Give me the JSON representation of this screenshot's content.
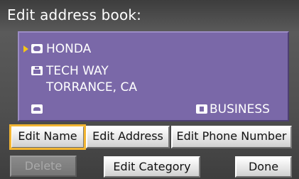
{
  "screen": {
    "title": "Edit address book:"
  },
  "entry": {
    "name": "HONDA",
    "street": "TECH WAY",
    "city": "TORRANCE, CA",
    "phone": "",
    "category": "BUSINESS"
  },
  "buttons": {
    "edit_name": "Edit Name",
    "edit_address": "Edit Address",
    "edit_phone": "Edit Phone Number",
    "delete": "Delete",
    "edit_category": "Edit Category",
    "done": "Done"
  },
  "state": {
    "selected_button": "Edit Name",
    "delete_enabled": false
  },
  "colors": {
    "panel": "#7a68a8",
    "highlight": "#f2b532",
    "cursor": "#f5c518"
  },
  "icons": {
    "name": "name-tag-icon",
    "address": "house-icon",
    "phone": "phone-icon",
    "category": "business-icon",
    "cursor": "cursor-arrow-icon"
  }
}
